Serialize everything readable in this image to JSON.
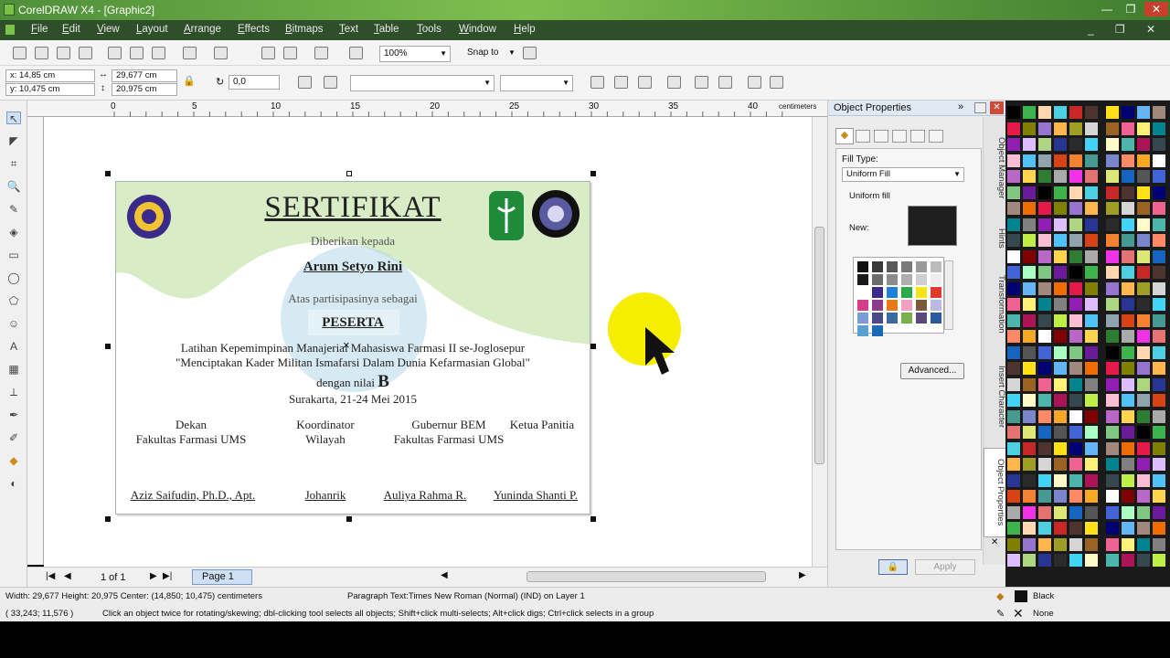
{
  "title": "CorelDRAW X4 - [Graphic2]",
  "window_buttons": {
    "minimize": "—",
    "restore": "❐",
    "close": "✕"
  },
  "menu": [
    "File",
    "Edit",
    "View",
    "Layout",
    "Arrange",
    "Effects",
    "Bitmaps",
    "Text",
    "Table",
    "Tools",
    "Window",
    "Help"
  ],
  "standard_bar": {
    "zoom": "100%",
    "snap_to": "Snap to"
  },
  "property_bar": {
    "x": "x: 14,85 cm",
    "y": "y: 10,475 cm",
    "width": "29,677 cm",
    "height": "20,975 cm",
    "angle": "0,0",
    "font": "",
    "font_size": ""
  },
  "ruler": {
    "unit": "centimeters",
    "labels": [
      "0",
      "5",
      "10",
      "15",
      "20",
      "25",
      "30",
      "35",
      "40"
    ]
  },
  "certificate": {
    "heading": "SERTIFIKAT",
    "given_to": "Diberikan kepada",
    "name": "Arum Setyo Rini",
    "for_participation": "Atas partisipasinya sebagai",
    "role": "PESERTA",
    "event_line1": "Latihan Kepemimpinan Manajerial Mahasiswa Farmasi II se-Joglosepur",
    "event_line2": "\"Menciptakan Kader Militan Ismafarsi Dalam Dunia Kefarmasian Global\"",
    "grade_label": "dengan nilai",
    "grade": "B",
    "place_date": "Surakarta, 21-24 Mei 2015",
    "signers": [
      {
        "title1": "Dekan",
        "title2": "Fakultas Farmasi UMS",
        "name": "Aziz Saifudin, Ph.D., Apt."
      },
      {
        "title1": "Koordinator",
        "title2": "Wilayah",
        "name": "Johanrik"
      },
      {
        "title1": "Gubernur BEM",
        "title2": "Fakultas Farmasi UMS",
        "name": "Auliya Rahma R."
      },
      {
        "title1": "Ketua Panitia",
        "title2": "",
        "name": "Yuninda Shanti P."
      }
    ]
  },
  "page_nav": {
    "page_count": "1 of 1",
    "tab": "Page 1"
  },
  "docker": {
    "title": "Object Properties",
    "fill_type_label": "Fill Type:",
    "fill_type_value": "Uniform Fill",
    "fill_subtitle": "Uniform fill",
    "new_label": "New:",
    "new_color": "#1e1e1e",
    "advanced_button": "Advanced...",
    "apply_button": "Apply",
    "mini_swatches": [
      "#111111",
      "#3a3a3a",
      "#5a5a5a",
      "#7a7a7a",
      "#999999",
      "#bbbbbb",
      "#1a1a1a",
      "#6b6b6b",
      "#8c8c8c",
      "#adadad",
      "#cfcfcf",
      "#eeeeee",
      "#ffffff",
      "#3a2a8a",
      "#1f7fd4",
      "#2aa84a",
      "#f3e51a",
      "#e03a2a",
      "#d63c8c",
      "#8c3a8c",
      "#e87a1a",
      "#f0a0c0",
      "#7a5a3a",
      "#b8b8e0",
      "#7a9ad4",
      "#4a4a8a",
      "#3a6aa0",
      "#7ab04a",
      "#5a4a7a",
      "#2a5aa0",
      "#5aa0d0",
      "#1a6ab8"
    ]
  },
  "docker_tabs": [
    "Object Manager",
    "Hints",
    "Transformation",
    "Insert Character",
    "Object Properties"
  ],
  "palette_colors": [
    "#000000",
    "#2b2b2b",
    "#555555",
    "#808080",
    "#aaaaaa",
    "#d5d5d5",
    "#ffffff",
    "#e6194b",
    "#f58231",
    "#ffe119",
    "#bfef45",
    "#3cb44b",
    "#42d4f4",
    "#4363d8",
    "#911eb4",
    "#f032e6",
    "#9a6324",
    "#800000",
    "#808000",
    "#469990",
    "#000075",
    "#fabed4",
    "#ffd8b1",
    "#fffac8",
    "#aaffc3",
    "#dcbeff",
    "#e57373",
    "#f06292",
    "#ba68c8",
    "#9575cd",
    "#7986cb",
    "#64b5f6",
    "#4fc3f7",
    "#4dd0e1",
    "#4db6ac",
    "#81c784",
    "#aed581",
    "#dce775",
    "#fff176",
    "#ffd54f",
    "#ffb74d",
    "#ff8a65",
    "#a1887f",
    "#90a4ae",
    "#c62828",
    "#ad1457",
    "#6a1b9a",
    "#283593",
    "#1565c0",
    "#00838f",
    "#2e7d32",
    "#9e9d24",
    "#f9a825",
    "#ef6c00",
    "#d84315",
    "#4e342e",
    "#37474f"
  ],
  "status": {
    "dimensions": "Width: 29,677  Height: 20,975  Center: (14,850; 10,475)  centimeters",
    "object_info": "Paragraph Text:Times New Roman (Normal) (IND) on Layer 1",
    "cursor_pos": "( 33,243; 11,576 )",
    "hint": "Click an object twice for rotating/skewing; dbl-clicking tool selects all objects; Shift+click multi-selects; Alt+click digs; Ctrl+click selects in a group",
    "fill": "Black",
    "outline": "None"
  }
}
